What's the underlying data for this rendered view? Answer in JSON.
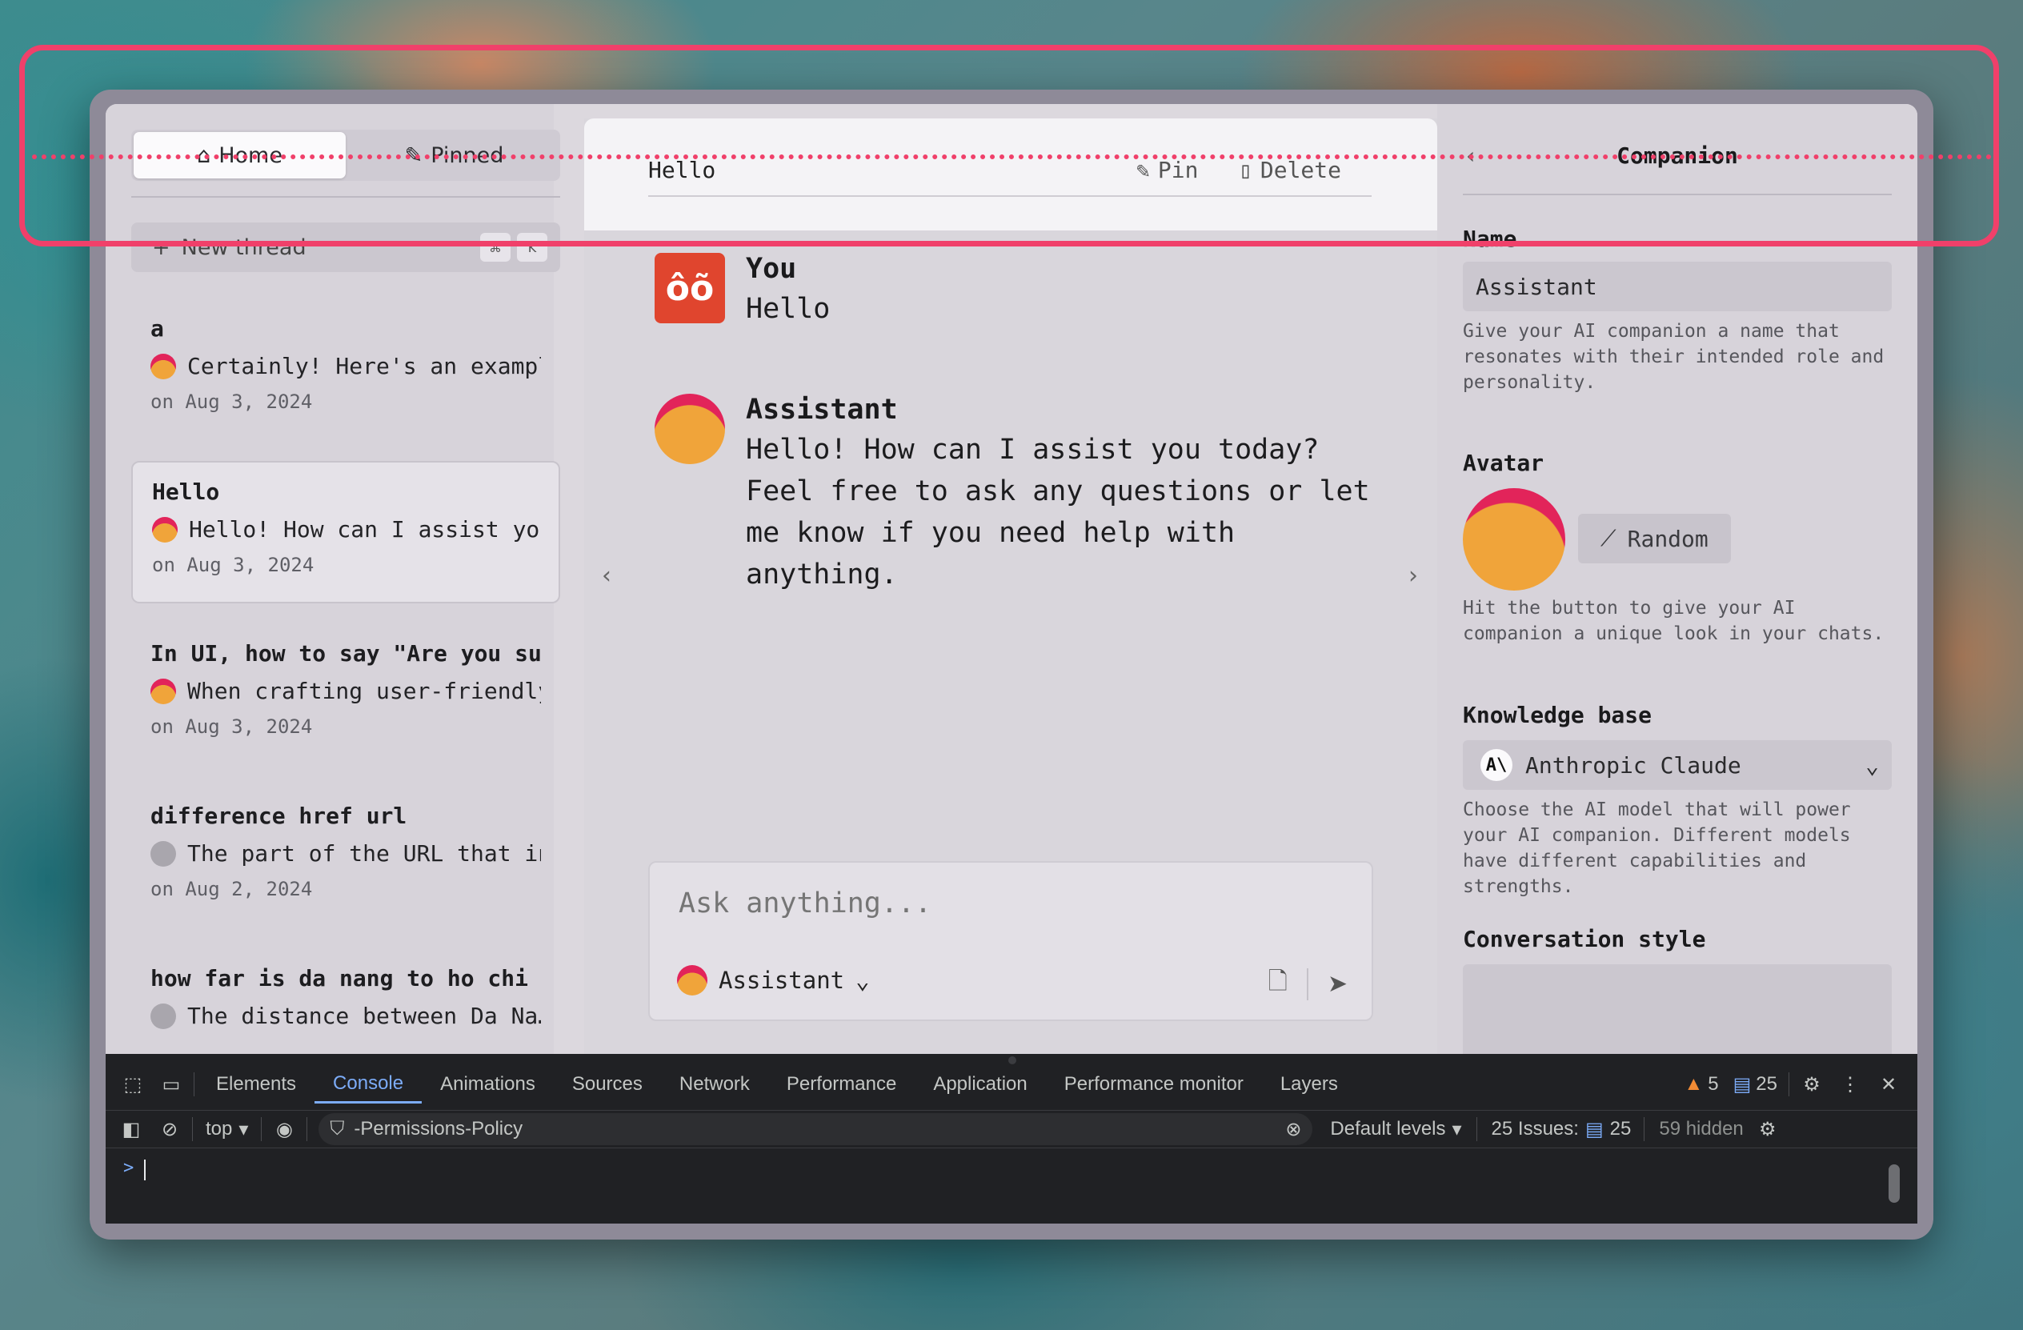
{
  "left": {
    "tabs": [
      {
        "label": "Home",
        "icon": "home-icon",
        "active": true
      },
      {
        "label": "Pinned",
        "icon": "pin-icon",
        "active": false
      }
    ],
    "new_thread": {
      "label": "New thread",
      "icon": "plus-icon",
      "keys": [
        "⌘",
        "K"
      ]
    },
    "threads": [
      {
        "title": "a",
        "snippet": "Certainly! Here's an exampl…",
        "date": "on Aug 3, 2024",
        "avatar": "assistant"
      },
      {
        "title": "Hello",
        "snippet": "Hello! How can I assist you…",
        "date": "on Aug 3, 2024",
        "avatar": "assistant",
        "selected": true
      },
      {
        "title": "In UI, how to say \"Are you sur…",
        "snippet": "When crafting user-friendly…",
        "date": "on Aug 3, 2024",
        "avatar": "assistant"
      },
      {
        "title": "difference href url",
        "snippet": "The part of the URL that inc…",
        "date": "on Aug 2, 2024",
        "avatar": "grey"
      },
      {
        "title": "how far is da nang to ho chi m…",
        "snippet": "The distance between Da Na…",
        "date": "",
        "avatar": "grey"
      }
    ]
  },
  "center": {
    "title": "Hello",
    "actions": {
      "pin": "Pin",
      "delete": "Delete"
    },
    "messages": [
      {
        "author": "You",
        "text": "Hello",
        "avatar_text": "ôõ"
      },
      {
        "author": "Assistant",
        "text": "Hello! How can I assist you today? Feel free to ask any questions or let me know if you need help with anything."
      }
    ],
    "composer": {
      "placeholder": "Ask anything...",
      "model": "Assistant"
    }
  },
  "right": {
    "title": "Companion",
    "name_label": "Name",
    "name_value": "Assistant",
    "name_help": "Give your AI companion a name that resonates with their intended role and personality.",
    "avatar_label": "Avatar",
    "random_label": "Random",
    "avatar_help": "Hit the button to give your AI companion a unique look in your chats.",
    "kb_label": "Knowledge base",
    "kb_value": "Anthropic Claude",
    "kb_logo": "A\\",
    "kb_help": "Choose the AI model that will power your AI companion. Different models have different capabilities and strengths.",
    "style_label": "Conversation style"
  },
  "devtools": {
    "tabs": [
      "Elements",
      "Console",
      "Animations",
      "Sources",
      "Network",
      "Performance",
      "Application",
      "Performance monitor",
      "Layers"
    ],
    "active_tab": "Console",
    "warnings": "5",
    "messages": "25",
    "context": "top",
    "filter": "-Permissions-Policy",
    "levels": "Default levels",
    "issues_label": "25 Issues:",
    "issues_count": "25",
    "hidden": "59 hidden",
    "prompt": ">"
  },
  "colors": {
    "highlight": "#f0406a",
    "accent_devtools": "#7cacf8",
    "assistant_avatar": "#e2245a",
    "you_avatar": "#e0452e"
  }
}
